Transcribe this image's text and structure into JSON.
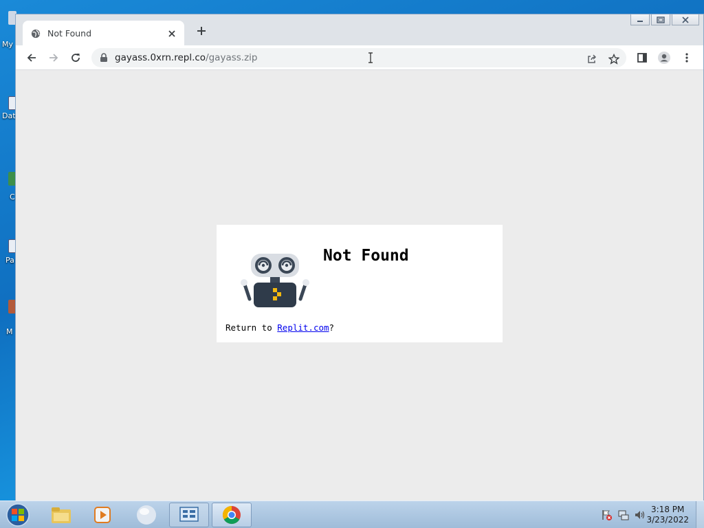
{
  "desktop": {
    "icons": [
      {
        "label": "My"
      },
      {
        "label": "Dat"
      },
      {
        "label": "C"
      },
      {
        "label": "Pa"
      },
      {
        "label": "M"
      }
    ]
  },
  "browser": {
    "tab": {
      "title": "Not Found",
      "favicon": "globe-icon"
    },
    "new_tab_icon": "plus-icon",
    "window_controls": [
      "minimize-icon",
      "restore-icon",
      "close-icon"
    ],
    "url": {
      "host": "gayass.0xrn.repl.co",
      "path": "/gayass.zip"
    },
    "toolbar_icons": [
      "back-icon",
      "forward-icon",
      "reload-icon",
      "lock-icon",
      "share-icon",
      "star-icon",
      "side-panel-icon",
      "profile-icon",
      "menu-icon"
    ]
  },
  "page": {
    "title": "Not Found",
    "return_prefix": "Return to ",
    "link_text": "Replit.com",
    "return_suffix": "?"
  },
  "taskbar": {
    "items": [
      "start-orb-icon",
      "file-explorer-icon",
      "media-player-icon",
      "globe-app-icon",
      "control-panel-icon",
      "chrome-icon"
    ],
    "active": "chrome-icon",
    "clock": {
      "time": "3:18 PM",
      "date": "3/23/2022"
    }
  },
  "colors": {
    "accent": "#1a73e8",
    "link": "#0000ee",
    "taskbar": "#b0c8e2"
  }
}
